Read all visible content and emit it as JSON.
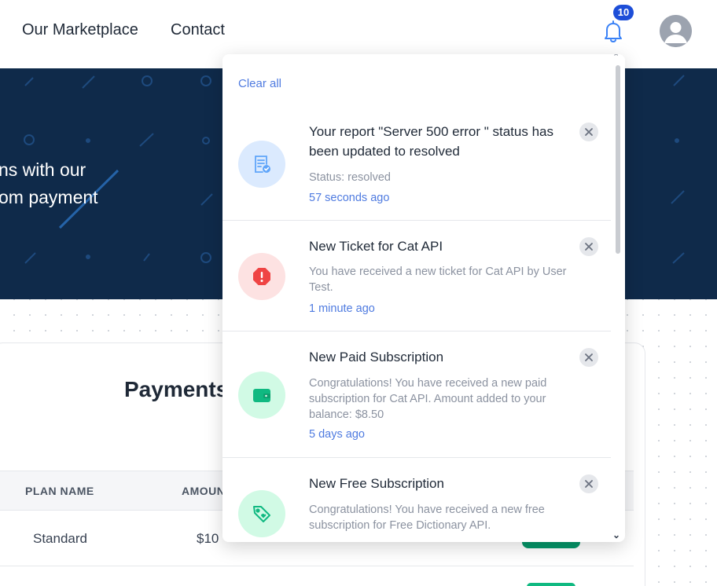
{
  "nav": {
    "links": [
      "Our Marketplace",
      "Contact"
    ],
    "notification_count": "10"
  },
  "hero": {
    "line1": "ns with our",
    "line2": "om payment"
  },
  "payments": {
    "title": "Payments",
    "columns": [
      "PLAN NAME",
      "AMOUNT"
    ],
    "rows": [
      {
        "plan": "Standard",
        "amount": "$10"
      }
    ]
  },
  "notifications": {
    "clear_all": "Clear all",
    "items": [
      {
        "title": "Your report \"Server 500 error \" status has been updated to resolved",
        "body": "Status: resolved",
        "time": "57 seconds ago",
        "icon": "report-check-icon",
        "icon_bg": "#dbeafe",
        "icon_color": "#60a5fa"
      },
      {
        "title": "New Ticket for Cat API",
        "body": "You have received a new ticket for Cat API by User Test.",
        "time": "1 minute ago",
        "icon": "alert-octagon-icon",
        "icon_bg": "#fde2e2",
        "icon_color": "#ef4444"
      },
      {
        "title": "New Paid Subscription",
        "body": "Congratulations! You have received a new paid subscription for Cat API. Amount added to your balance: $8.50",
        "time": "5 days ago",
        "icon": "wallet-icon",
        "icon_bg": "#d1fae5",
        "icon_color": "#10b981"
      },
      {
        "title": "New Free Subscription",
        "body": "Congratulations! You have received a new free subscription for Free Dictionary API.",
        "time": "",
        "icon": "tag-heart-icon",
        "icon_bg": "#d1fae5",
        "icon_color": "#10b981"
      }
    ]
  },
  "colors": {
    "hero_bg": "#0f2a4a",
    "link_blue": "#4f7be0",
    "badge_blue": "#1d4ed8"
  }
}
